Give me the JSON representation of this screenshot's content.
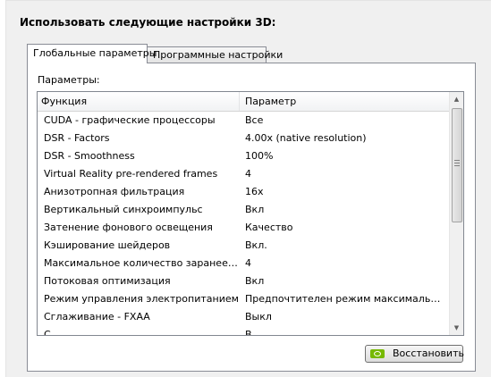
{
  "heading": "Использовать следующие настройки 3D:",
  "tabs": [
    {
      "label": "Глобальные параметры"
    },
    {
      "label": "Программные настройки"
    }
  ],
  "params_label": "Параметры:",
  "table": {
    "headers": [
      "Функция",
      "Параметр"
    ],
    "rows": [
      [
        "CUDA - графические процессоры",
        "Все"
      ],
      [
        "DSR - Factors",
        "4.00x (native resolution)"
      ],
      [
        "DSR - Smoothness",
        "100%"
      ],
      [
        "Virtual Reality pre-rendered frames",
        "4"
      ],
      [
        "Анизотропная фильтрация",
        "16x"
      ],
      [
        "Вертикальный синхроимпульс",
        "Вкл"
      ],
      [
        "Затенение фонового освещения",
        "Качество"
      ],
      [
        "Кэширование шейдеров",
        "Вкл."
      ],
      [
        "Максимальное количество заранее под...",
        "4"
      ],
      [
        "Потоковая оптимизация",
        "Вкл"
      ],
      [
        "Режим управления электропитанием",
        "Предпочтителен режим максимальной п..."
      ],
      [
        "Сглаживание - FXAA",
        "Выкл"
      ],
      [
        "С...",
        "В..."
      ]
    ]
  },
  "restore_button": "Восстановить"
}
